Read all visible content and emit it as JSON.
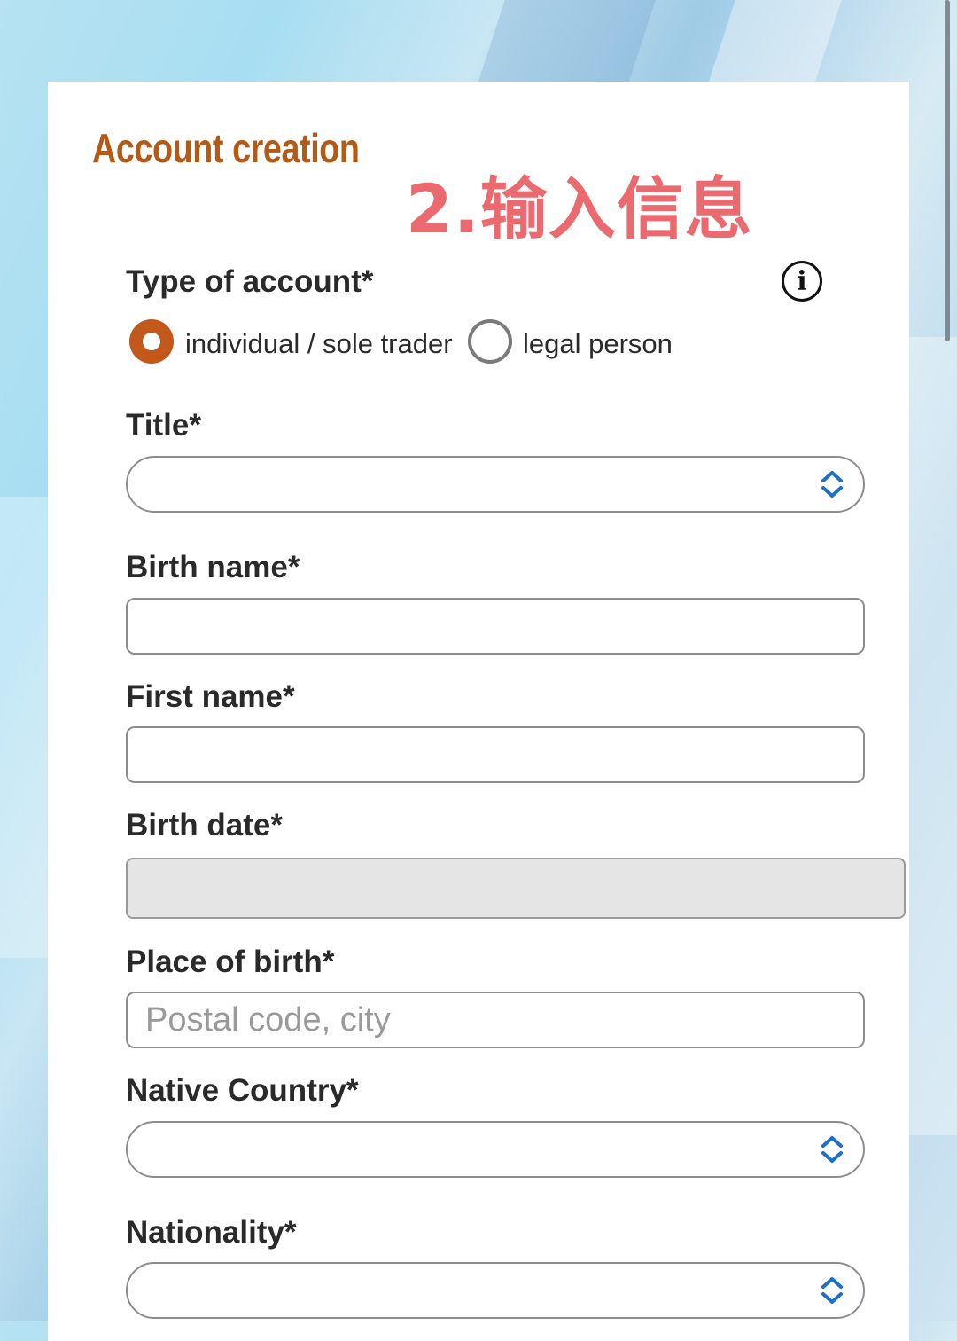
{
  "form": {
    "title": "Account creation",
    "overlay_note": "2.输入信息",
    "account_type": {
      "label": "Type of account*",
      "info_icon": "info-circle-icon",
      "options": [
        {
          "label": "individual / sole trader",
          "selected": true
        },
        {
          "label": "legal person",
          "selected": false
        }
      ]
    },
    "fields": {
      "title": {
        "label": "Title*",
        "value": ""
      },
      "birth_name": {
        "label": "Birth name*",
        "value": ""
      },
      "first_name": {
        "label": "First name*",
        "value": ""
      },
      "birth_date": {
        "label": "Birth date*",
        "value": ""
      },
      "place_of_birth": {
        "label": "Place of birth*",
        "placeholder": "Postal code, city",
        "value": ""
      },
      "native_country": {
        "label": "Native Country*",
        "value": ""
      },
      "nationality": {
        "label": "Nationality*",
        "value": ""
      }
    }
  },
  "colors": {
    "accent": "#c2581a",
    "title": "#b35a16",
    "overlay": "#ea6a6f",
    "chevron": "#1f6fc7"
  }
}
